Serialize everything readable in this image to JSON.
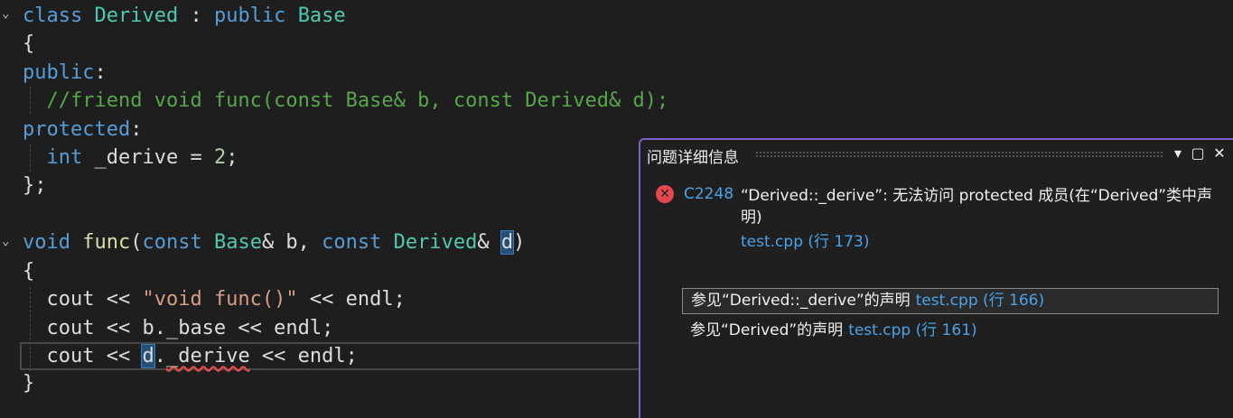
{
  "editor": {
    "lines": {
      "l1": {
        "kw1": "class",
        "ty1": "Derived",
        "op": " : ",
        "kw2": "public",
        "ty2": "Base"
      },
      "l2": {
        "text": "{"
      },
      "l3": {
        "kw": "public",
        "op": ":"
      },
      "l4": {
        "comment": "//friend void func(const Base& b, const Derived& d);"
      },
      "l5": {
        "kw": "protected",
        "op": ":"
      },
      "l6": {
        "kw": "int",
        "rest": " _derive = ",
        "num": "2",
        "end": ";"
      },
      "l7": {
        "text": "};"
      },
      "l8": {
        "kw1": "void",
        "fn": "func",
        "p1": "(",
        "kw2": "const",
        "ty1": "Base",
        "p2": "& b, ",
        "kw3": "const",
        "ty2": "Derived",
        "p3": "& ",
        "sel": "d",
        "p4": ")"
      },
      "l9": {
        "text": "{"
      },
      "l10": {
        "a": "cout << ",
        "str": "\"void func()\"",
        "b": " << endl;"
      },
      "l11": {
        "text": "cout << b._base << endl;"
      },
      "l12": {
        "a": "cout << ",
        "sel": "d",
        "b": ".",
        "squig": "_derive",
        "c": " << endl;"
      },
      "l13": {
        "text": "}"
      }
    },
    "fold_marker": "⌄"
  },
  "popup": {
    "title": "问题详细信息",
    "buttons": {
      "dropdown": "▾",
      "maximize": "▢",
      "close": "✕"
    },
    "error": {
      "icon": "✕",
      "code": "C2248",
      "message": "“Derived::_derive”: 无法访问 protected 成员(在“Derived”类中声明)",
      "location": "test.cpp (行 173)"
    },
    "see_also": [
      {
        "text": "参见“Derived::_derive”的声明",
        "link": "test.cpp (行 166)"
      },
      {
        "text": "参见“Derived”的声明",
        "link": "test.cpp (行 161)"
      }
    ]
  },
  "colors": {
    "accent": "#7b61c9",
    "error": "#e5484d",
    "link": "#4aa3e8"
  }
}
